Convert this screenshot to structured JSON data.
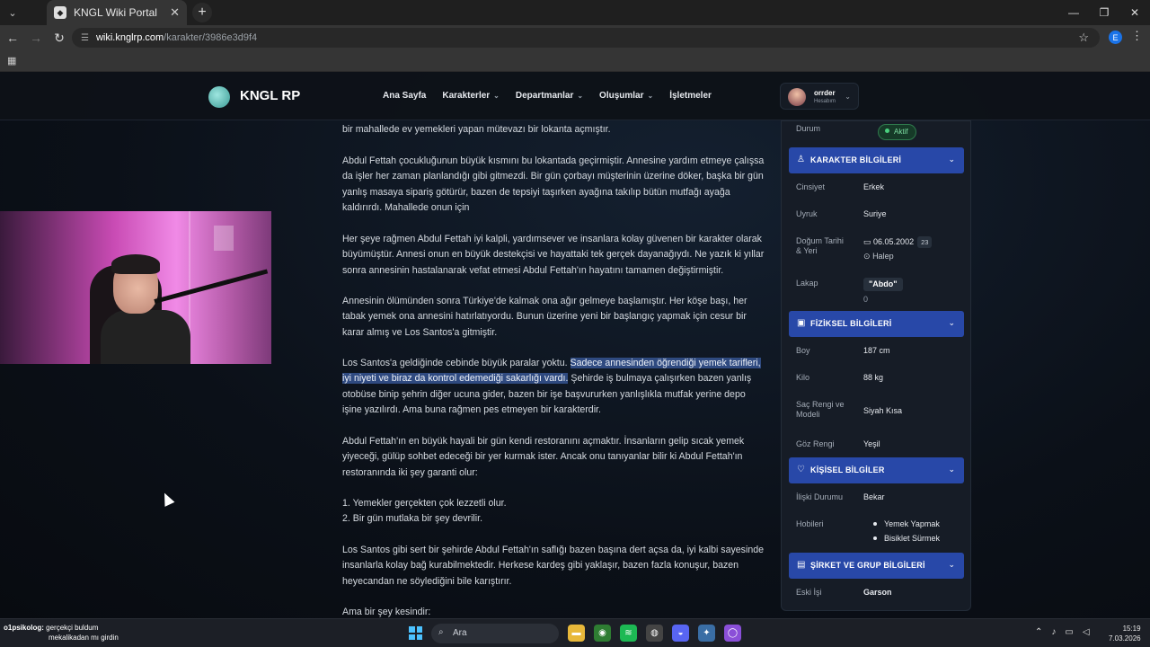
{
  "browser": {
    "tab_title": "KNGL Wiki Portal",
    "url_host": "wiki.knglrp.com",
    "url_path": "/karakter/3986e3d9f4",
    "profile_letter": "E"
  },
  "site": {
    "logo": "KNGL RP",
    "nav": [
      {
        "label": "Ana Sayfa",
        "dropdown": false
      },
      {
        "label": "Karakterler",
        "dropdown": true
      },
      {
        "label": "Departmanlar",
        "dropdown": true
      },
      {
        "label": "Oluşumlar",
        "dropdown": true
      },
      {
        "label": "İşletmeler",
        "dropdown": false
      }
    ],
    "user": {
      "name": "orrder",
      "sub": "Hesabım"
    }
  },
  "article": {
    "p0": "bir mahallede ev yemekleri yapan mütevazı bir lokanta açmıştır.",
    "p1": "Abdul Fettah çocukluğunun büyük kısmını bu lokantada geçirmiştir. Annesine yardım etmeye çalışsa da işler her zaman planlandığı gibi gitmezdi. Bir gün çorbayı müşterinin üzerine döker, başka bir gün yanlış masaya sipariş götürür, bazen de tepsiyi taşırken ayağına takılıp bütün mutfağı ayağa kaldırırdı. Mahallede onun için",
    "p2": "Her şeye rağmen Abdul Fettah iyi kalpli, yardımsever ve insanlara kolay güvenen bir karakter olarak büyümüştür. Annesi onun en büyük destekçisi ve hayattaki tek gerçek dayanağıydı. Ne yazık ki yıllar sonra annesinin hastalanarak vefat etmesi Abdul Fettah'ın hayatını tamamen değiştirmiştir.",
    "p3": "Annesinin ölümünden sonra Türkiye'de kalmak ona ağır gelmeye başlamıştır. Her köşe başı, her tabak yemek ona annesini hatırlatıyordu. Bunun üzerine yeni bir başlangıç yapmak için cesur bir karar almış ve Los Santos'a gitmiştir.",
    "p4_a": "Los Santos'a geldiğinde cebinde büyük paralar yoktu.",
    "p4_b": "Sadece annesinden öğrendiği yemek tarifleri, iyi niyeti ve biraz da kontrol edemediği sakarlığı vardı.",
    "p4_c": "Şehirde iş bulmaya çalışırken bazen yanlış otobüse binip şehrin diğer ucuna gider, bazen bir işe başvururken yanlışlıkla mutfak yerine depo işine yazılırdı. Ama buna rağmen pes etmeyen bir karakterdir.",
    "p5": "Abdul Fettah'ın en büyük hayali bir gün kendi restoranını açmaktır. İnsanların gelip sıcak yemek yiyeceği, gülüp sohbet edeceği bir yer kurmak ister. Ancak onu tanıyanlar bilir ki Abdul Fettah'ın restoranında iki şey garanti olur:",
    "list1": "1. Yemekler gerçekten çok lezzetli olur.",
    "list2": "2. Bir gün mutlaka bir şey devrilir.",
    "p6": "Los Santos gibi sert bir şehirde Abdul Fettah'ın saflığı bazen başına dert açsa da, iyi kalbi sayesinde insanlarla kolay bağ kurabilmektedir. Herkese kardeş gibi yaklaşır, bazen fazla konuşur, bazen heyecandan ne söylediğini bile karıştırır.",
    "p7": "Ama bir şey kesindir:"
  },
  "panel": {
    "durum_label": "Durum",
    "durum_value": "Aktif",
    "sec_karakter": "KARAKTER BİLGİLERİ",
    "cinsiyet_label": "Cinsiyet",
    "cinsiyet_value": "Erkek",
    "uyruk_label": "Uyruk",
    "uyruk_value": "Suriye",
    "dogum_label": "Doğum Tarihi & Yeri",
    "dogum_date": "06.05.2002",
    "dogum_age": "23",
    "dogum_place": "Halep",
    "lakap_label": "Lakap",
    "lakap_value": "\"Abdo\"",
    "lakap_count": "0",
    "sec_fiziksel": "FİZİKSEL BİLGİLERİ",
    "boy_label": "Boy",
    "boy_value": "187 cm",
    "kilo_label": "Kilo",
    "kilo_value": "88 kg",
    "sac_label": "Saç Rengi ve Modeli",
    "sac_value": "Siyah Kısa",
    "goz_label": "Göz Rengi",
    "goz_value": "Yeşil",
    "sec_kisisel": "KİŞİSEL BİLGİLER",
    "iliski_label": "İlişki Durumu",
    "iliski_value": "Bekar",
    "hobi_label": "Hobileri",
    "hobi_1": "Yemek Yapmak",
    "hobi_2": "Bisiklet Sürmek",
    "sec_sirket": "ŞİRKET VE GRUP BİLGİLERİ",
    "eski_label": "Eski İşi",
    "eski_value": "Garson"
  },
  "overlay": {
    "chat_user": "o1psikolog:",
    "chat_msg1": "gerçekçi buldum",
    "chat_msg2": "mekalikadan mı girdin"
  },
  "taskbar": {
    "search": "Ara",
    "time": "15:19",
    "date": "7.03.2026"
  },
  "colors": {
    "section_bg": "#2848a8",
    "highlight": "#2f4a80",
    "status_green": "#4ad07f"
  }
}
